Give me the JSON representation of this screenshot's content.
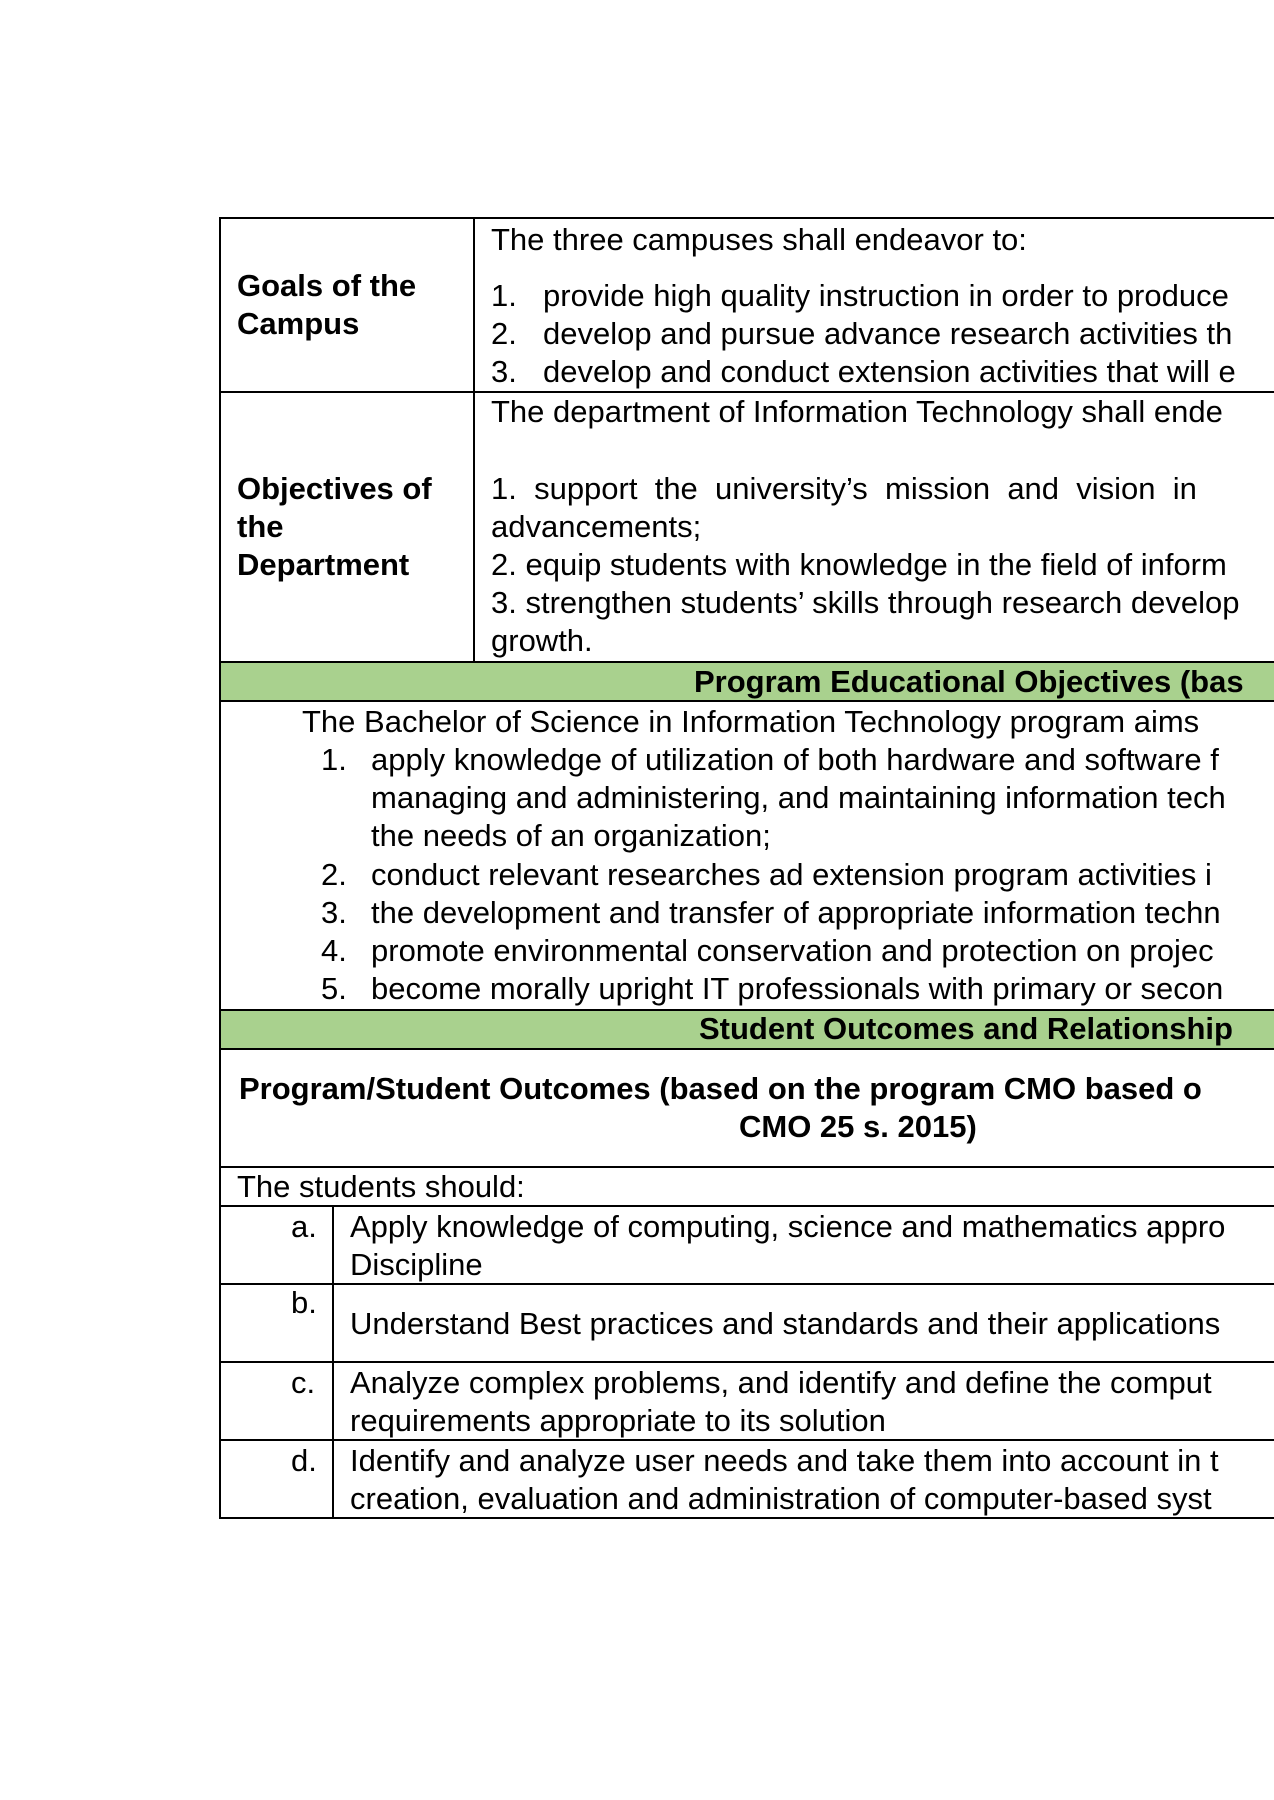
{
  "goals": {
    "label": [
      "Goals of the",
      "Campus"
    ],
    "intro": "The three campuses shall endeavor to:",
    "items": [
      {
        "num": "1.",
        "text": "provide high quality instruction in order to produce"
      },
      {
        "num": "2.",
        "text": "develop and pursue advance research activities th"
      },
      {
        "num": "3.",
        "text": "develop and conduct extension activities that will e"
      }
    ]
  },
  "objectives": {
    "label": [
      "Objectives of",
      "the",
      "Department"
    ],
    "intro": "The department of Information Technology shall ende",
    "lines": [
      "1.  support  the  university’s  mission  and  vision  in",
      "advancements;",
      "2. equip students with knowledge in the field of inform",
      "3. strengthen students’ skills through research develop",
      "growth."
    ]
  },
  "peo": {
    "heading": "Program Educational Objectives (bas",
    "intro": "The Bachelor of Science in Information Technology program aims",
    "items": [
      {
        "num": "1.",
        "lines": [
          "apply knowledge of utilization of both hardware and software f",
          "managing and administering, and maintaining information tech",
          "the needs of an organization;"
        ]
      },
      {
        "num": "2.",
        "lines": [
          "conduct relevant researches ad extension program activities i"
        ]
      },
      {
        "num": "3.",
        "lines": [
          "the development and transfer of appropriate information techn"
        ]
      },
      {
        "num": "4.",
        "lines": [
          "promote environmental conservation and protection on projec"
        ]
      },
      {
        "num": "5.",
        "lines": [
          "become morally upright IT professionals with primary or secon"
        ]
      }
    ]
  },
  "student_outcomes": {
    "band_heading": "Student Outcomes and Relationship",
    "subheading": [
      "Program/Student Outcomes (based on the program CMO based o",
      "CMO 25 s. 2015)"
    ],
    "intro": "The students should:",
    "items": [
      {
        "letter": "a.",
        "lines": [
          "Apply knowledge of computing, science and mathematics appro",
          "Discipline"
        ]
      },
      {
        "letter": "b.",
        "lines": [
          "Understand Best practices and standards and their applications"
        ]
      },
      {
        "letter": "c.",
        "lines": [
          "Analyze complex problems, and identify and define the comput",
          "requirements appropriate to its solution"
        ]
      },
      {
        "letter": "d.",
        "lines": [
          "Identify and analyze user needs and take them into account in t",
          "creation, evaluation and administration of computer-based syst"
        ]
      }
    ]
  },
  "colors": {
    "band": "#a9d18e",
    "border": "#000000"
  }
}
